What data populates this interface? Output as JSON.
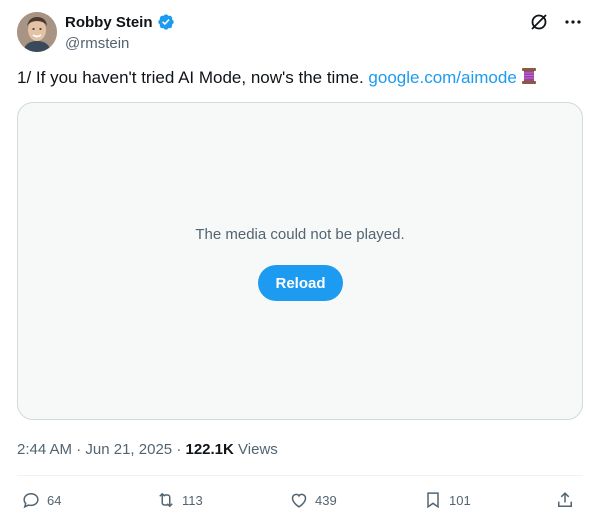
{
  "author": {
    "display_name": "Robby Stein",
    "handle": "@rmstein"
  },
  "tweet": {
    "text": "1/ If you haven't tried AI Mode, now's the time.",
    "link_text": "google.com/aimode"
  },
  "media": {
    "message": "The media could not be played.",
    "reload_label": "Reload"
  },
  "meta": {
    "time": "2:44 AM",
    "separator": "·",
    "date": "Jun 21, 2025",
    "views_count": "122.1K",
    "views_label": "Views"
  },
  "actions": {
    "replies": "64",
    "reposts": "113",
    "likes": "439",
    "bookmarks": "101"
  },
  "colors": {
    "accent": "#1d9bf0",
    "text": "#0f1419",
    "muted": "#536471",
    "border": "#cfd9de"
  },
  "icons": [
    "verified-badge-icon",
    "grok-icon",
    "more-icon",
    "thread-emoji-icon",
    "reply-icon",
    "repost-icon",
    "like-icon",
    "bookmark-icon",
    "share-icon"
  ]
}
